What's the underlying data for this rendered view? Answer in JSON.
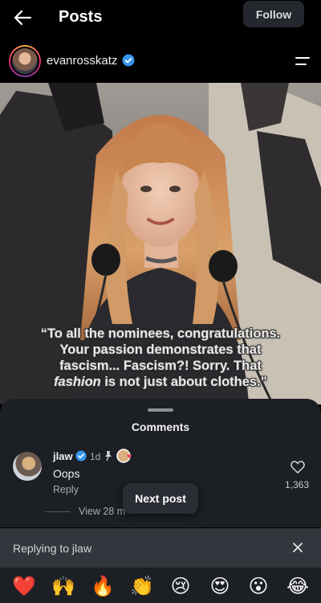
{
  "header": {
    "title": "Posts",
    "follow_label": "Follow"
  },
  "profile": {
    "username": "evanrosskatz",
    "verified": true
  },
  "post": {
    "quote_lines": [
      "“To all the nominees, congratulations.",
      "Your passion demonstrates that",
      "fascism... Fascism?! Sorry. That"
    ],
    "quote_last_emph": "fashion",
    "quote_last_rest": " is not just about clothes.”"
  },
  "comments": {
    "title": "Comments",
    "items": [
      {
        "user": "jlaw",
        "verified": true,
        "time": "1d",
        "pinned": true,
        "text": "Oops",
        "reply_label": "Reply",
        "likes": "1,363",
        "view_replies": "View 28 m"
      }
    ]
  },
  "next_post_label": "Next post",
  "reply_bar": {
    "text": "Replying to jlaw"
  },
  "emojis": [
    {
      "name": "red-heart",
      "char": "❤️"
    },
    {
      "name": "raising-hands",
      "char": "🙌"
    },
    {
      "name": "fire",
      "char": "🔥"
    },
    {
      "name": "clapping-hands",
      "char": "👏"
    },
    {
      "name": "crying-face",
      "char": "😢"
    },
    {
      "name": "heart-eyes",
      "char": "😍"
    },
    {
      "name": "surprised-face",
      "char": "😮"
    },
    {
      "name": "tears-of-joy",
      "char": "😂"
    }
  ],
  "colors": {
    "verified": "#3897f0",
    "background": "#000000",
    "sheet": "#1c1f24"
  }
}
